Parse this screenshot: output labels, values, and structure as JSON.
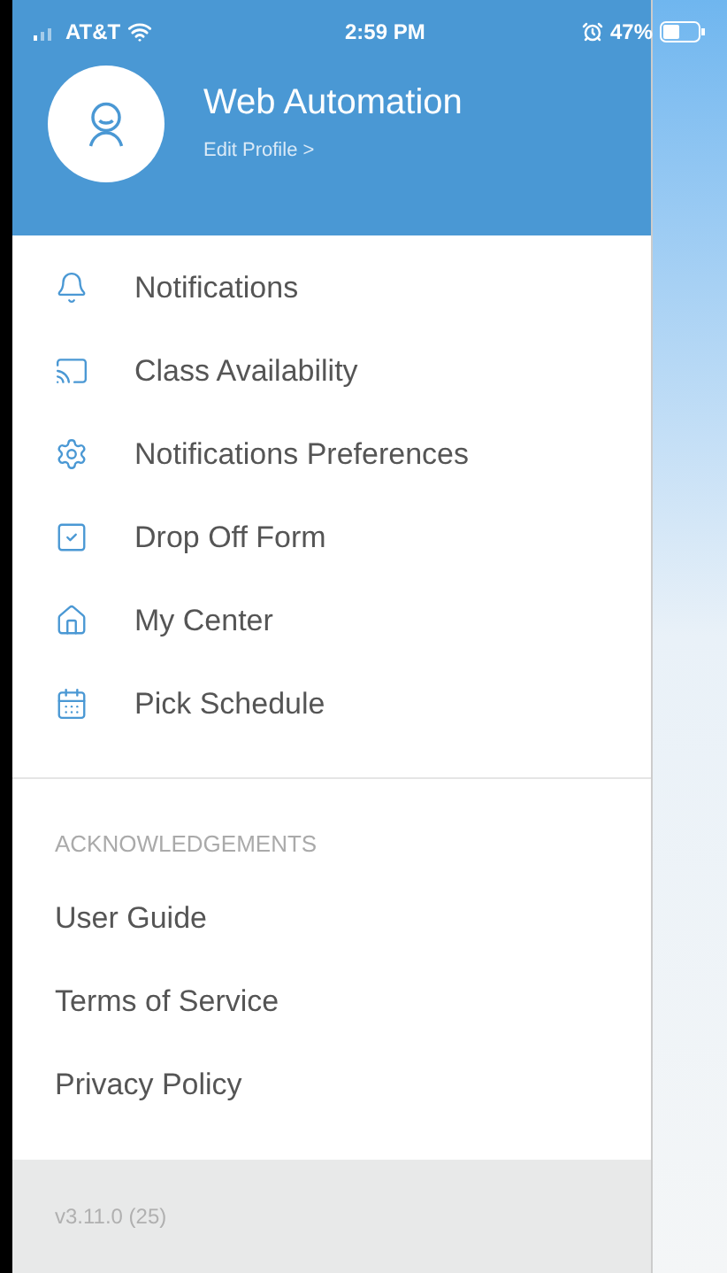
{
  "status_bar": {
    "carrier": "AT&T",
    "time": "2:59 PM",
    "battery": "47%"
  },
  "profile": {
    "name": "Web Automation",
    "edit_link": "Edit Profile >"
  },
  "menu": [
    {
      "label": "Notifications",
      "kind": "bell"
    },
    {
      "label": "Class Availability",
      "kind": "screen"
    },
    {
      "label": "Notifications Preferences",
      "kind": "gear"
    },
    {
      "label": "Drop Off Form",
      "kind": "form"
    },
    {
      "label": "My Center",
      "kind": "house"
    },
    {
      "label": "Pick Schedule",
      "kind": "calendar"
    }
  ],
  "section": {
    "title": "ACKNOWLEDGEMENTS",
    "links": [
      "User Guide",
      "Terms of Service",
      "Privacy Policy"
    ]
  },
  "footer": {
    "version": "v3.11.0 (25)"
  }
}
